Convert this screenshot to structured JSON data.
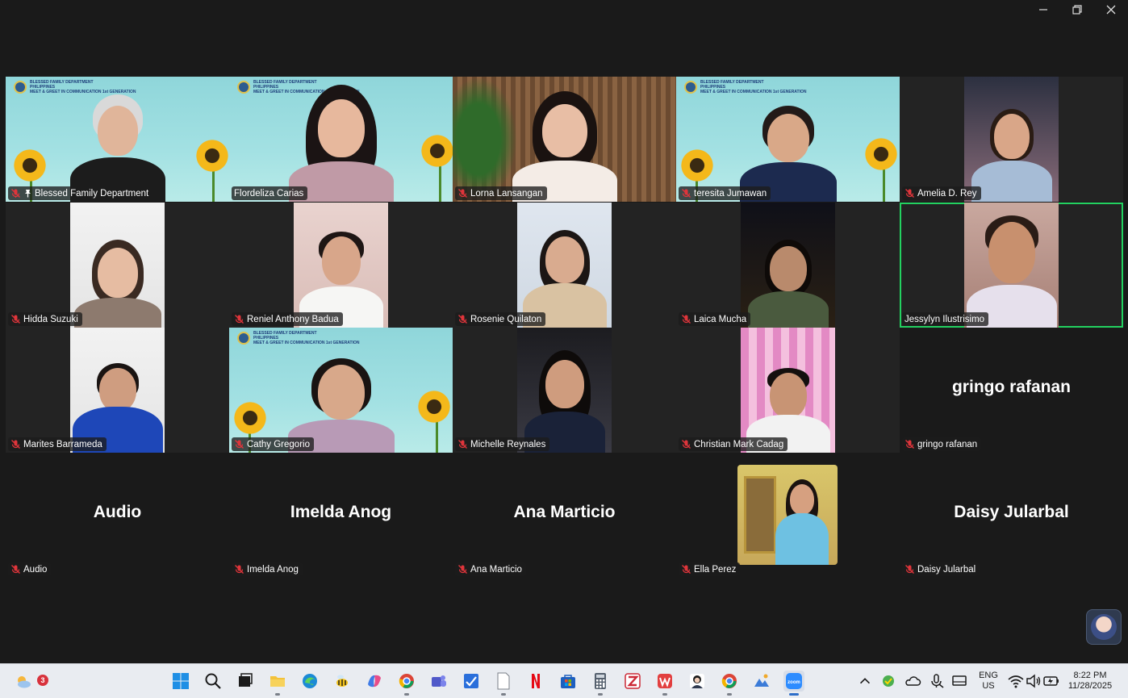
{
  "window": {
    "controls": [
      "minimize",
      "restore",
      "close"
    ]
  },
  "banner": {
    "line1": "BLESSED FAMILY DEPARTMENT",
    "line2": "PHILIPPINES",
    "line3": "MEET & GREET IN COMMUNICATION 1st GENERATION"
  },
  "participants": [
    {
      "name": "Blessed Family Department",
      "muted": true,
      "pinned": true
    },
    {
      "name": "Flordeliza Carias",
      "muted": false
    },
    {
      "name": "Lorna Lansangan",
      "muted": true
    },
    {
      "name": "teresita Jumawan",
      "muted": true
    },
    {
      "name": "Amelia D. Rey",
      "muted": true
    },
    {
      "name": "Hidda Suzuki",
      "muted": true
    },
    {
      "name": "Reniel Anthony Badua",
      "muted": true
    },
    {
      "name": "Rosenie Quilaton",
      "muted": true
    },
    {
      "name": "Laica Mucha",
      "muted": true
    },
    {
      "name": "Jessylyn Ilustrisimo",
      "muted": false,
      "active_speaker": true
    },
    {
      "name": "Marites Barrameda",
      "muted": true
    },
    {
      "name": "Cathy Gregorio",
      "muted": true
    },
    {
      "name": "Michelle Reynales",
      "muted": true
    },
    {
      "name": "Christian Mark Cadag",
      "muted": true
    },
    {
      "name": "gringo rafanan",
      "muted": true,
      "video_off": true
    },
    {
      "name": "Audio",
      "muted": true,
      "video_off": true
    },
    {
      "name": "Imelda Anog",
      "muted": true,
      "video_off": true
    },
    {
      "name": "Ana Marticio",
      "muted": true,
      "video_off": true
    },
    {
      "name": "Ella Perez",
      "muted": true
    },
    {
      "name": "Daisy Jularbal",
      "muted": true,
      "video_off": true
    }
  ],
  "taskbar": {
    "weather_badge": "3",
    "apps": [
      "start",
      "search",
      "task-view",
      "file-explorer",
      "edge",
      "bee-app",
      "copilot",
      "chrome",
      "teams",
      "todo",
      "notepad",
      "netflix",
      "store",
      "calculator",
      "zotero",
      "wps",
      "avatar-app",
      "chrome-profile",
      "photos",
      "zoom"
    ],
    "tray": {
      "lang_line1": "ENG",
      "lang_line2": "US",
      "time": "8:22 PM",
      "date": "11/28/2025"
    }
  },
  "colors": {
    "active_speaker_border": "#23d160",
    "muted_icon": "#e0353b",
    "background": "#1a1a1a",
    "taskbar": "#e9ecf1"
  }
}
